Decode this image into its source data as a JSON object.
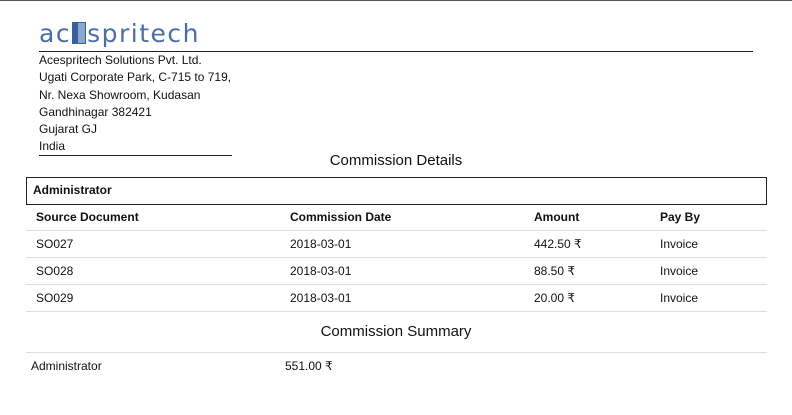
{
  "company": {
    "logo_text_before": "ac",
    "logo_text_after": "spritech",
    "address_lines": [
      "Acespritech Solutions Pvt. Ltd.",
      "Ugati Corporate Park, C-715 to 719,",
      "Nr. Nexa Showroom, Kudasan",
      "Gandhinagar 382421",
      "Gujarat GJ",
      "India"
    ]
  },
  "details": {
    "title": "Commission Details",
    "group_label": "Administrator",
    "columns": [
      "Source Document",
      "Commission Date",
      "Amount",
      "Pay By"
    ],
    "rows": [
      {
        "source": "SO027",
        "date": "2018-03-01",
        "amount": "442.50 ₹",
        "pay_by": "Invoice"
      },
      {
        "source": "SO028",
        "date": "2018-03-01",
        "amount": "88.50 ₹",
        "pay_by": "Invoice"
      },
      {
        "source": "SO029",
        "date": "2018-03-01",
        "amount": "20.00 ₹",
        "pay_by": "Invoice"
      }
    ]
  },
  "summary": {
    "title": "Commission Summary",
    "rows": [
      {
        "name": "Administrator",
        "total": "551.00 ₹"
      }
    ]
  }
}
